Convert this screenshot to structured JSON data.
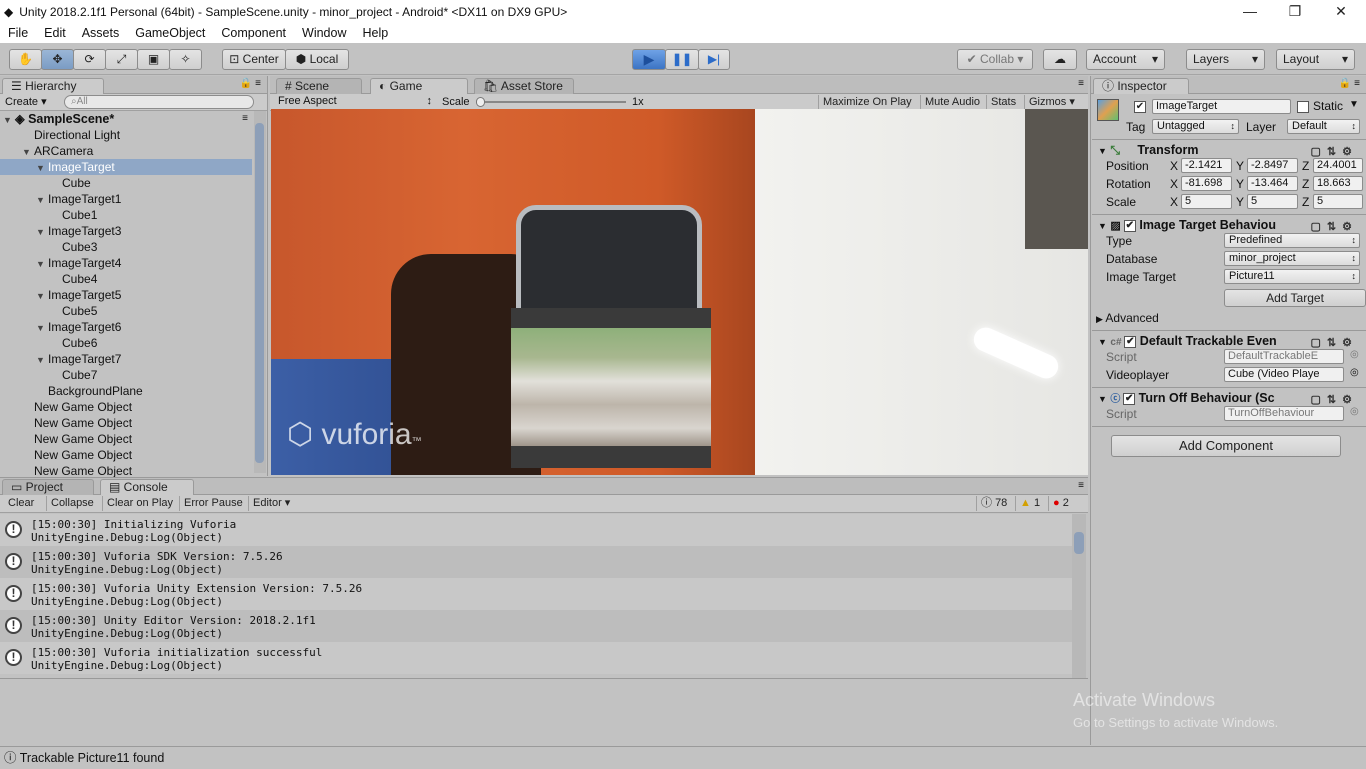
{
  "window": {
    "title": "Unity 2018.2.1f1 Personal (64bit) - SampleScene.unity - minor_project - Android* <DX11 on DX9 GPU>",
    "minimize": "—",
    "restore": "❐",
    "close": "✕"
  },
  "menu": [
    "File",
    "Edit",
    "Assets",
    "GameObject",
    "Component",
    "Window",
    "Help"
  ],
  "toolbar": {
    "tools": [
      "hand-icon",
      "move-icon",
      "rotate-icon",
      "scale-icon",
      "rect-icon",
      "transform-icon"
    ],
    "pivot": "Center",
    "space": "Local",
    "collab": "Collab",
    "account": "Account",
    "layers": "Layers",
    "layout": "Layout"
  },
  "hierarchy": {
    "tab": "Hierarchy",
    "create": "Create",
    "search_placeholder": "All",
    "scene": "SampleScene*",
    "items": [
      {
        "label": "Directional Light",
        "indent": 1,
        "tri": ""
      },
      {
        "label": "ARCamera",
        "indent": 1,
        "tri": "▼"
      },
      {
        "label": "ImageTarget",
        "indent": 2,
        "tri": "▼",
        "selected": true
      },
      {
        "label": "Cube",
        "indent": 3,
        "tri": ""
      },
      {
        "label": "ImageTarget1",
        "indent": 2,
        "tri": "▼"
      },
      {
        "label": "Cube1",
        "indent": 3,
        "tri": ""
      },
      {
        "label": "ImageTarget3",
        "indent": 2,
        "tri": "▼"
      },
      {
        "label": "Cube3",
        "indent": 3,
        "tri": ""
      },
      {
        "label": "ImageTarget4",
        "indent": 2,
        "tri": "▼"
      },
      {
        "label": "Cube4",
        "indent": 3,
        "tri": ""
      },
      {
        "label": "ImageTarget5",
        "indent": 2,
        "tri": "▼"
      },
      {
        "label": "Cube5",
        "indent": 3,
        "tri": ""
      },
      {
        "label": "ImageTarget6",
        "indent": 2,
        "tri": "▼"
      },
      {
        "label": "Cube6",
        "indent": 3,
        "tri": ""
      },
      {
        "label": "ImageTarget7",
        "indent": 2,
        "tri": "▼"
      },
      {
        "label": "Cube7",
        "indent": 3,
        "tri": ""
      },
      {
        "label": "BackgroundPlane",
        "indent": 2,
        "tri": ""
      },
      {
        "label": "New Game Object",
        "indent": 1,
        "tri": ""
      },
      {
        "label": "New Game Object",
        "indent": 1,
        "tri": ""
      },
      {
        "label": "New Game Object",
        "indent": 1,
        "tri": ""
      },
      {
        "label": "New Game Object",
        "indent": 1,
        "tri": ""
      },
      {
        "label": "New Game Object",
        "indent": 1,
        "tri": ""
      }
    ]
  },
  "center_tabs": {
    "scene": "Scene",
    "game": "Game",
    "asset_store": "Asset Store"
  },
  "game_bar": {
    "aspect": "Free Aspect",
    "scale_label": "Scale",
    "scale_value": "1x",
    "maximize": "Maximize On Play",
    "mute": "Mute Audio",
    "stats": "Stats",
    "gizmos": "Gizmos"
  },
  "game_view": {
    "watermark": "vuforia",
    "watermark_tm": "™"
  },
  "console": {
    "tabs": {
      "project": "Project",
      "console": "Console"
    },
    "buttons": [
      "Clear",
      "Collapse",
      "Clear on Play",
      "Error Pause",
      "Editor"
    ],
    "counts": {
      "info": "78",
      "warn": "1",
      "error": "2"
    },
    "entries": [
      {
        "line1": "[15:00:30] Initializing Vuforia",
        "line2": "UnityEngine.Debug:Log(Object)"
      },
      {
        "line1": "[15:00:30] Vuforia SDK Version: 7.5.26",
        "line2": "UnityEngine.Debug:Log(Object)"
      },
      {
        "line1": "[15:00:30] Vuforia Unity Extension Version: 7.5.26",
        "line2": "UnityEngine.Debug:Log(Object)"
      },
      {
        "line1": "[15:00:30] Unity Editor Version: 2018.2.1f1",
        "line2": "UnityEngine.Debug:Log(Object)"
      },
      {
        "line1": "[15:00:30] Vuforia initialization successful",
        "line2": "UnityEngine.Debug:Log(Object)"
      }
    ]
  },
  "inspector": {
    "tab": "Inspector",
    "object_name": "ImageTarget",
    "static_label": "Static",
    "tag_label": "Tag",
    "tag_value": "Untagged",
    "layer_label": "Layer",
    "layer_value": "Default",
    "transform": {
      "title": "Transform",
      "position_label": "Position",
      "rotation_label": "Rotation",
      "scale_label": "Scale",
      "position": {
        "x": "-2.1421",
        "y": "-2.8497",
        "z": "24.4001"
      },
      "rotation": {
        "x": "-81.698",
        "y": "-13.464",
        "z": "18.663"
      },
      "scale": {
        "x": "5",
        "y": "5",
        "z": "5"
      }
    },
    "image_target": {
      "title": "Image Target Behaviou",
      "type_label": "Type",
      "type_value": "Predefined",
      "database_label": "Database",
      "database_value": "minor_project",
      "target_label": "Image Target",
      "target_value": "Picture11",
      "add_target": "Add Target",
      "advanced": "Advanced"
    },
    "trackable": {
      "title": "Default Trackable Even",
      "script_label": "Script",
      "script_value": "DefaultTrackableE",
      "videoplayer_label": "Videoplayer",
      "videoplayer_value": "Cube (Video Playe"
    },
    "turnoff": {
      "title": "Turn Off Behaviour (Sc",
      "script_label": "Script",
      "script_value": "TurnOffBehaviour"
    },
    "add_component": "Add Component",
    "watermark_line1": "Activate Windows",
    "watermark_line2": "Go to Settings to activate Windows."
  },
  "status": "Trackable Picture11 found",
  "colors": {
    "play_active": "#5b8fd6",
    "selection": "#8fa7c6",
    "panel": "#c2c2c2"
  }
}
